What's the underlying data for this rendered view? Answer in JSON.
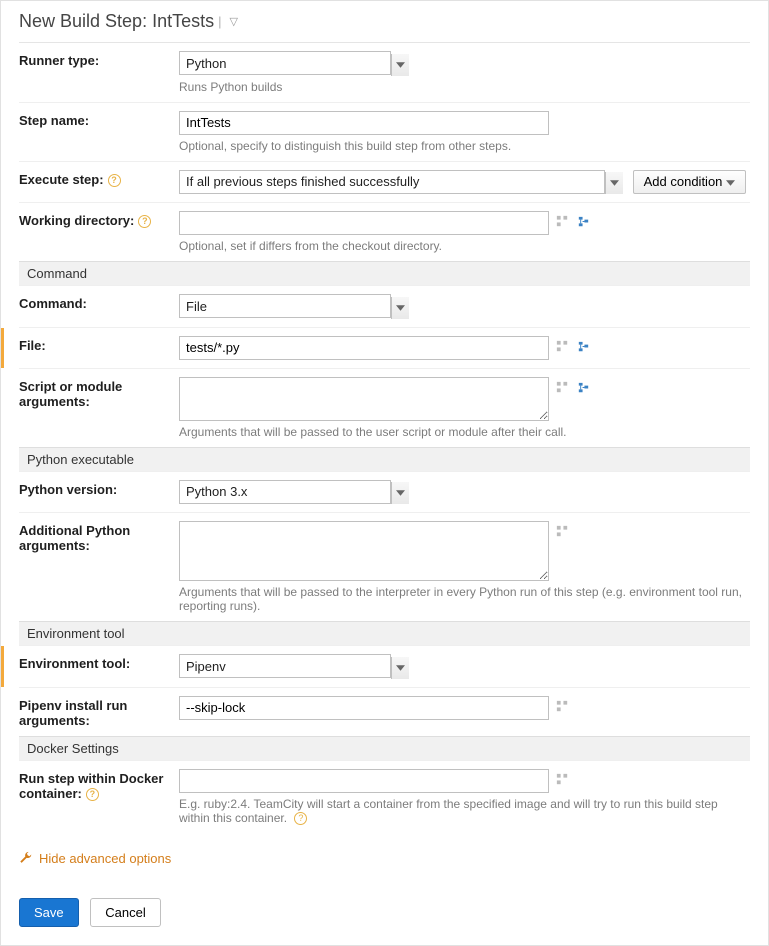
{
  "title": {
    "prefix": "New Build Step:",
    "name": "IntTests"
  },
  "runner_type": {
    "label": "Runner type:",
    "value": "Python",
    "hint": "Runs Python builds"
  },
  "step_name": {
    "label": "Step name:",
    "value": "IntTests",
    "hint": "Optional, specify to distinguish this build step from other steps."
  },
  "execute_step": {
    "label": "Execute step:",
    "value": "If all previous steps finished successfully",
    "add_condition": "Add condition"
  },
  "working_dir": {
    "label": "Working directory:",
    "value": "",
    "hint": "Optional, set if differs from the checkout directory."
  },
  "sections": {
    "command": "Command",
    "python_exec": "Python executable",
    "env_tool": "Environment tool",
    "docker": "Docker Settings"
  },
  "command": {
    "label": "Command:",
    "value": "File"
  },
  "file": {
    "label": "File:",
    "value": "tests/*.py"
  },
  "script_args": {
    "label_line1": "Script or module",
    "label_line2": "arguments:",
    "value": "",
    "hint": "Arguments that will be passed to the user script or module after their call."
  },
  "python_version": {
    "label": "Python version:",
    "value": "Python 3.x"
  },
  "additional_args": {
    "label_line1": "Additional Python",
    "label_line2": "arguments:",
    "value": "",
    "hint": "Arguments that will be passed to the interpreter in every Python run of this step (e.g. environment tool run, reporting runs)."
  },
  "env_tool": {
    "label": "Environment tool:",
    "value": "Pipenv"
  },
  "pipenv_args": {
    "label_line1": "Pipenv install run",
    "label_line2": "arguments:",
    "value": "--skip-lock"
  },
  "docker": {
    "label_line1": "Run step within Docker",
    "label_line2": "container:",
    "value": "",
    "hint": "E.g. ruby:2.4. TeamCity will start a container from the specified image and will try to run this build step within this container."
  },
  "advanced_toggle": "Hide advanced options",
  "buttons": {
    "save": "Save",
    "cancel": "Cancel"
  }
}
